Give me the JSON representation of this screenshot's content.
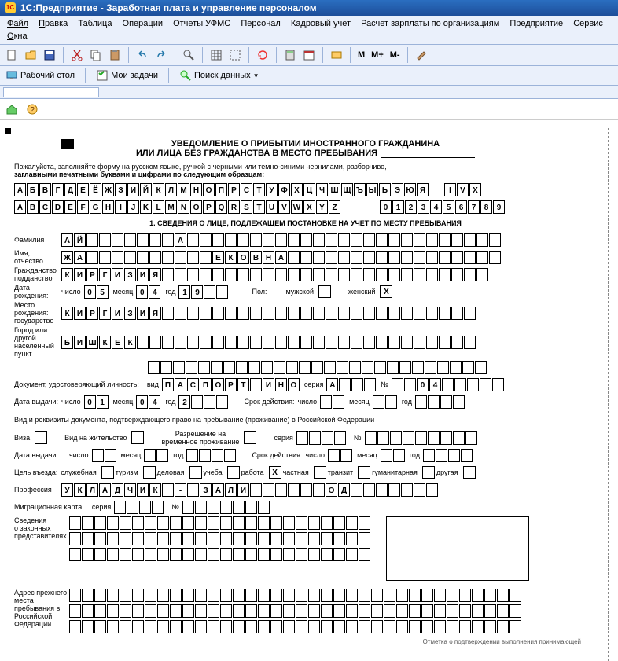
{
  "window": {
    "title": "1С:Предприятие - Заработная плата и управление персоналом"
  },
  "menu": [
    "Файл",
    "Правка",
    "Таблица",
    "Операции",
    "Отчеты УФМС",
    "Персонал",
    "Кадровый учет",
    "Расчет зарплаты по организациям",
    "Предприятие",
    "Сервис",
    "Окна"
  ],
  "toolbar2": {
    "desktop": "Рабочий стол",
    "tasks": "Мои задачи",
    "search": "Поиск данных"
  },
  "mbtns": [
    "M",
    "M+",
    "M-"
  ],
  "form": {
    "title1": "УВЕДОМЛЕНИЕ О ПРИБЫТИИ ИНОСТРАННОГО ГРАЖДАНИНА",
    "title2": "ИЛИ ЛИЦА БЕЗ ГРАЖДАНСТВА В МЕСТО ПРЕБЫВАНИЯ",
    "instr1": "Пожалуйста, заполняйте форму на русском языке, ручкой с черными или темно-синими чернилами, разборчиво,",
    "instr2": "заглавными печатными буквами и цифрами по следующим образцам:",
    "alpha_ru": "АБВГДЕЁЖЗИЙКЛМНОПРСТУФХЦЧШЩЪЫЬЭЮЯ",
    "alpha_lat": "ABCDEFGHIJKLMNOPQRSTUVWXYZ",
    "roman": "IVX",
    "digits": "0123456789",
    "section1": "1. СВЕДЕНИЯ О ЛИЦЕ, ПОДЛЕЖАЩЕМ ПОСТАНОВКЕ НА УЧЕТ ПО МЕСТУ ПРЕБЫВАНИЯ",
    "labels": {
      "surname": "Фамилия",
      "name": "Имя,\nотчество",
      "citizenship": "Гражданство\nподданство",
      "dob": "Дата\nрождения:",
      "num": "число",
      "mon": "месяц",
      "yr": "год",
      "sex": "Пол:",
      "male": "мужской",
      "female": "женский",
      "birthplace": "Место рождения:\nгосударство",
      "city": "Город или другой\nнаселенный пункт",
      "doc": "Документ, удостоверяющий личность:",
      "kind": "вид",
      "series": "серия",
      "no": "№",
      "issued": "Дата выдачи:",
      "valid": "Срок действия:",
      "docru": "Вид и реквизиты документа, подтверждающего право на пребывание (проживание) в Российской Федерации",
      "visa": "Виза",
      "residence": "Вид на жительство",
      "temp": "Разрешение на\nвременное проживание",
      "purpose": "Цель въезда:",
      "p1": "служебная",
      "p2": "туризм",
      "p3": "деловая",
      "p4": "учеба",
      "p5": "работа",
      "p6": "частная",
      "p7": "транзит",
      "p8": "гуманитарная",
      "p9": "другая",
      "prof": "Профессия",
      "migcard": "Миграционная карта:",
      "legal": "Сведения\nо законных\nпредставителях",
      "prevaddr": "Адрес прежнего\nместа\nпребывания в\nРоссийской\nФедерации",
      "footer": "Отметка о подтверждении выполнения принимающей"
    },
    "data": {
      "surname": "АЙ       А",
      "name": "ЖА          ЕКОВНА",
      "citizenship": "КИРГИЗИЯ",
      "dob_d": "05",
      "dob_m": "04",
      "dob_y": "19  ",
      "sex_female": "X",
      "birth_country": "КИРГИЗИЯ",
      "birth_city": "БИШКЕК",
      "doc_kind": "ПАСПОРТ ИНО",
      "doc_series": "А",
      "doc_no": "  04  ",
      "iss_d": "01",
      "iss_m": "04",
      "iss_y": "2   ",
      "purpose_work": "X",
      "profession": "УКЛАДЧИК - ЗАЛИ      ОД"
    }
  }
}
